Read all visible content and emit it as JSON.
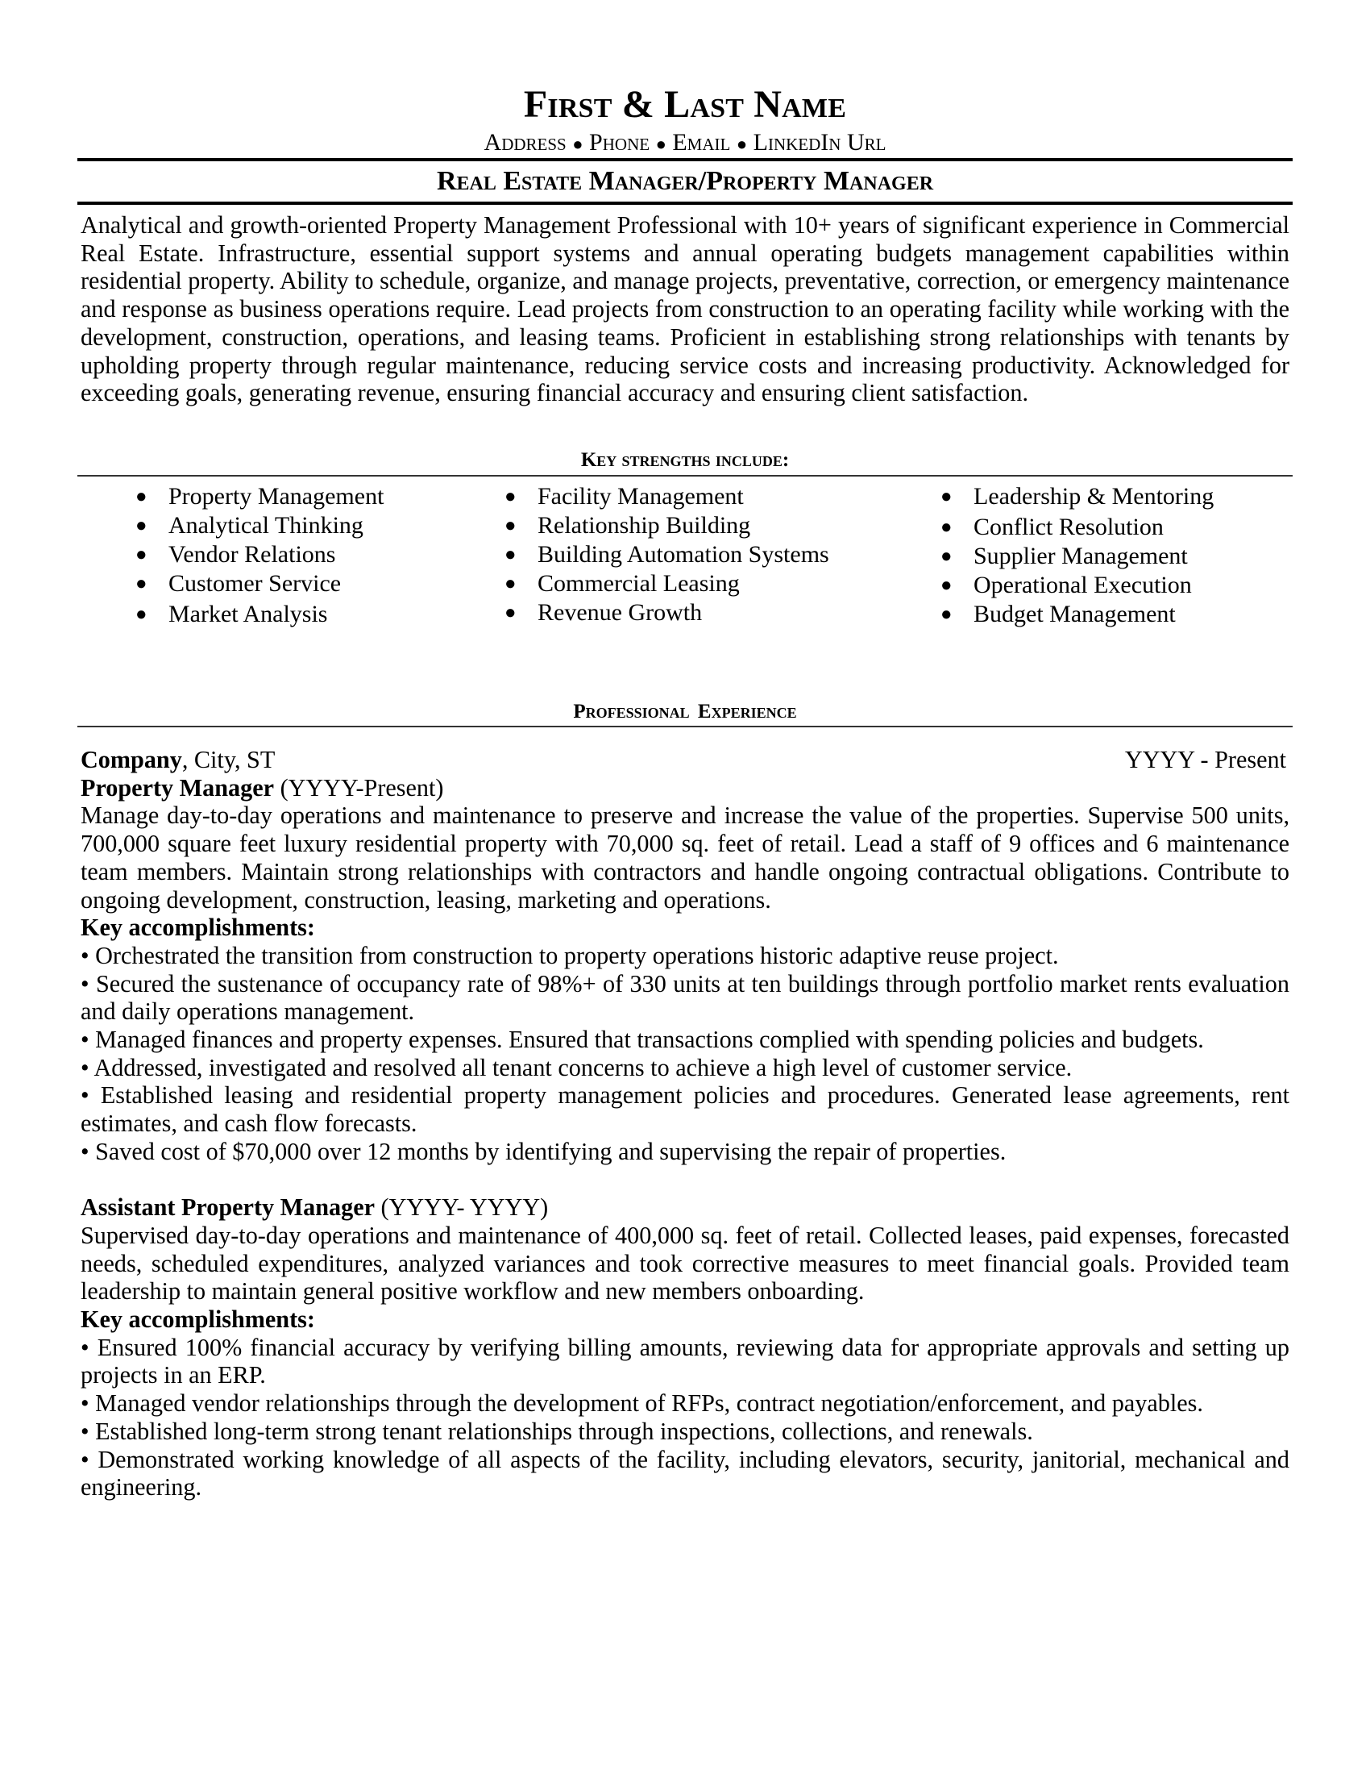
{
  "header": {
    "name": "First & Last Name",
    "contact": {
      "address": "Address",
      "phone": "Phone",
      "email": "Email",
      "linkedin": "LinkedIn Url",
      "separator": "●"
    },
    "title": "Real Estate Manager/Property Manager"
  },
  "summary": "Analytical and growth-oriented Property Management Professional with 10+ years of significant experience in Commercial Real Estate. Infrastructure, essential support systems and annual operating budgets management capabilities within residential property. Ability to schedule, organize, and manage projects, preventative, correction, or emergency maintenance and response as business operations require. Lead projects from construction to an operating facility while working with the development, construction, operations, and leasing teams. Proficient in establishing strong relationships with tenants by upholding property through regular maintenance, reducing service costs and increasing productivity. Acknowledged for exceeding goals, generating revenue, ensuring financial accuracy and ensuring client satisfaction.",
  "strengths": {
    "heading": "Key strengths include:",
    "bullet": "●",
    "columns": [
      [
        "Property Management",
        "Analytical Thinking",
        "Vendor Relations",
        "Customer Service",
        "Market Analysis"
      ],
      [
        "Facility Management",
        "Relationship Building",
        "Building Automation Systems",
        "Commercial Leasing",
        "Revenue Growth"
      ],
      [
        "Leadership & Mentoring",
        "Conflict Resolution",
        "Supplier Management",
        "Operational Execution",
        "Budget Management"
      ]
    ]
  },
  "experience": {
    "heading": "Professional  Experience",
    "company": {
      "name": "Company",
      "location": ", City, ST",
      "dates": "YYYY - Present"
    },
    "roles": [
      {
        "title": "Property Manager",
        "dates": " (YYYY-Present)",
        "description": "Manage day-to-day operations and maintenance to preserve and increase the value of the properties. Supervise 500 units, 700,000 square feet luxury residential property with 70,000 sq. feet of retail. Lead a staff of 9 offices and 6 maintenance team members. Maintain strong relationships with contractors and handle ongoing contractual obligations. Contribute to ongoing development, construction, leasing, marketing and operations.",
        "accomplishments_label": "Key accomplishments:",
        "accomplishments": [
          "• Orchestrated the transition from construction to property operations historic adaptive reuse project.",
          "• Secured the sustenance of occupancy rate of 98%+ of 330 units at ten buildings through portfolio market rents evaluation and daily operations management.",
          "• Managed finances and property expenses. Ensured that transactions complied with spending policies and budgets.",
          "• Addressed, investigated and resolved all tenant concerns to achieve a high level of customer service.",
          "• Established leasing and residential property management policies and procedures. Generated lease agreements, rent estimates, and cash flow forecasts.",
          "• Saved cost of $70,000 over 12 months by identifying and supervising the repair of properties."
        ]
      },
      {
        "title": "Assistant Property Manager",
        "dates": " (YYYY- YYYY)",
        "description": "Supervised day-to-day operations and maintenance of 400,000 sq. feet of retail.  Collected leases, paid expenses, forecasted needs, scheduled expenditures, analyzed variances and took corrective measures to meet financial goals. Provided team leadership to maintain general positive workflow and new members onboarding.",
        "accomplishments_label": "Key accomplishments:",
        "accomplishments": [
          "• Ensured 100% financial accuracy by verifying billing amounts, reviewing data for appropriate approvals and setting up projects in an ERP.",
          "• Managed vendor relationships through the development of RFPs, contract negotiation/enforcement, and payables.",
          "• Established long-term strong tenant relationships through inspections, collections, and renewals.",
          "• Demonstrated working knowledge of all aspects of the facility, including elevators, security, janitorial, mechanical and engineering."
        ]
      }
    ]
  }
}
